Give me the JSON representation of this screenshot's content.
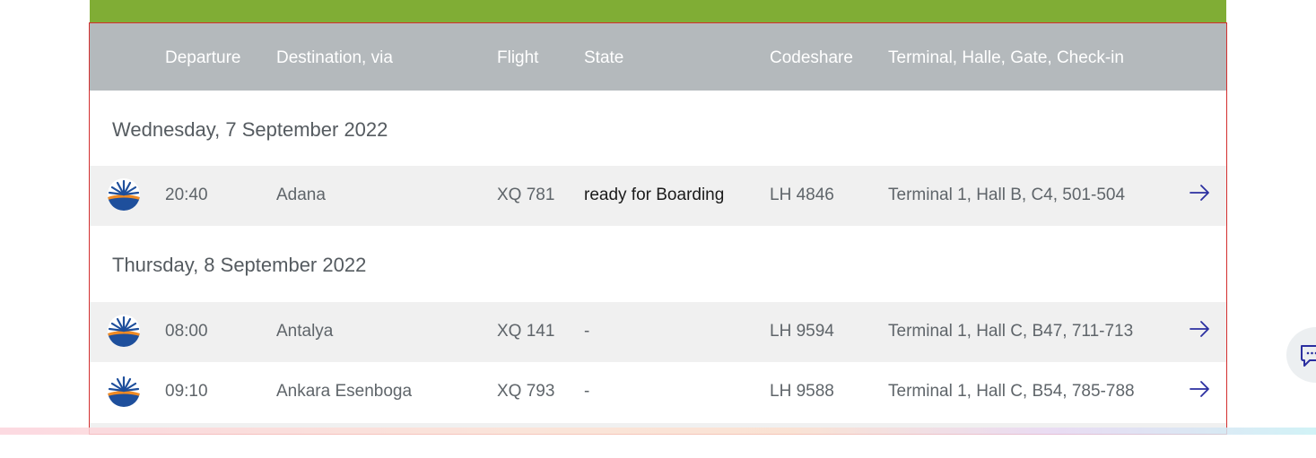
{
  "table": {
    "headers": {
      "departure": "Departure",
      "destination": "Destination, via",
      "flight": "Flight",
      "state": "State",
      "codeshare": "Codeshare",
      "terminal": "Terminal, Halle, Gate, Check-in"
    },
    "days": [
      {
        "label": "Wednesday, 7 September 2022",
        "flights": [
          {
            "time": "20:40",
            "destination": "Adana",
            "flight": "XQ 781",
            "state": "ready for Boarding",
            "codeshare": "LH 4846",
            "terminal": "Terminal 1, Hall B, C4, 501-504"
          }
        ]
      },
      {
        "label": "Thursday, 8 September 2022",
        "flights": [
          {
            "time": "08:00",
            "destination": "Antalya",
            "flight": "XQ 141",
            "state": "-",
            "codeshare": "LH 9594",
            "terminal": "Terminal 1, Hall C, B47, 711-713"
          },
          {
            "time": "09:10",
            "destination": "Ankara Esenboga",
            "flight": "XQ 793",
            "state": "-",
            "codeshare": "LH 9588",
            "terminal": "Terminal 1, Hall C, B54, 785-788"
          }
        ]
      }
    ]
  },
  "icons": {
    "airline_logo": "sunexpress-logo-icon",
    "row_arrow": "arrow-right-icon",
    "chat": "chat-icon"
  },
  "colors": {
    "accent_green": "#80ad35",
    "header_grey": "#b4b9bc",
    "frame_red": "#d32f2f",
    "arrow_blue": "#2b2fa0",
    "logo_blue": "#1e4f9c",
    "logo_orange": "#f08a24"
  }
}
